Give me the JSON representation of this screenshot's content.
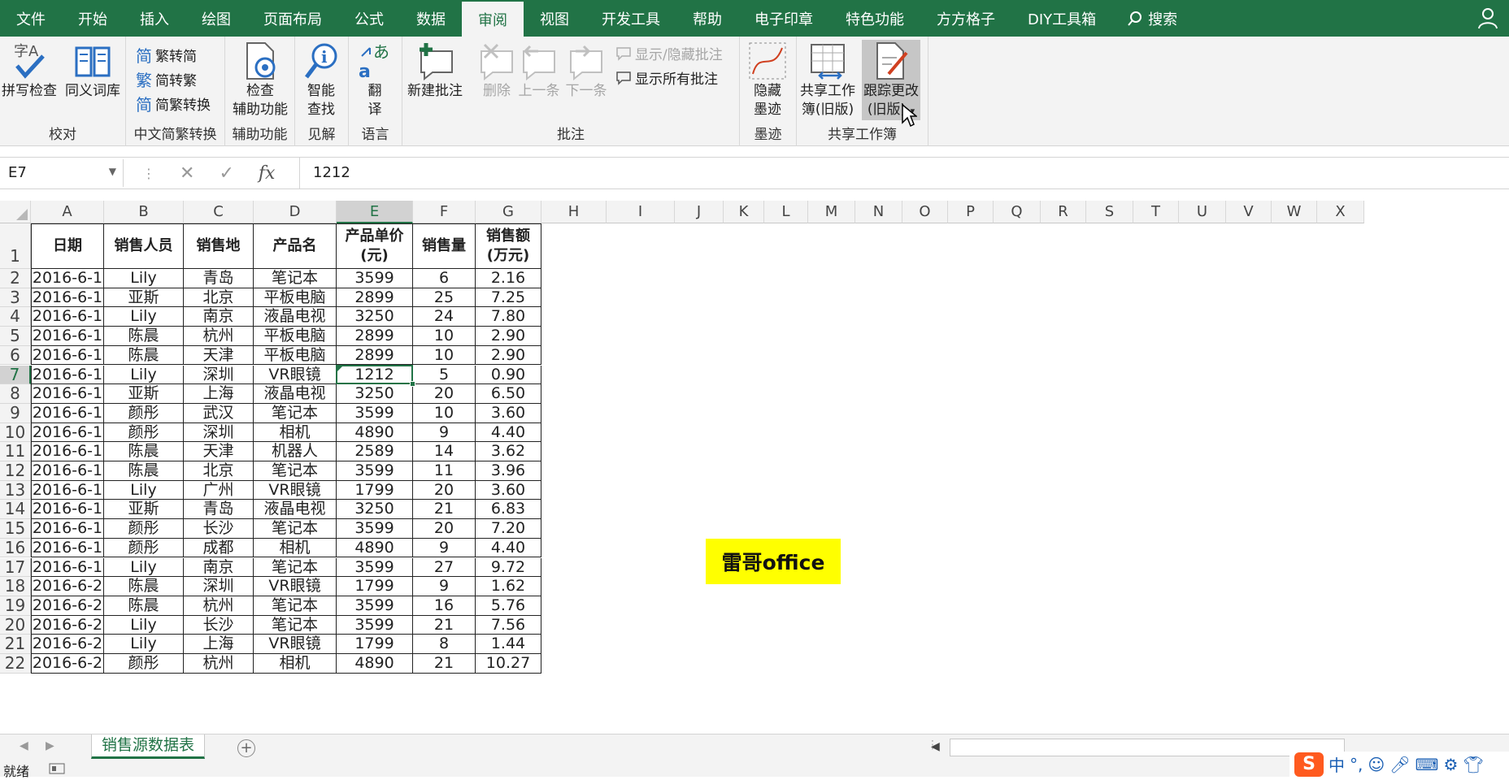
{
  "menu": {
    "tabs": [
      "文件",
      "开始",
      "插入",
      "绘图",
      "页面布局",
      "公式",
      "数据",
      "审阅",
      "视图",
      "开发工具",
      "帮助",
      "电子印章",
      "特色功能",
      "方方格子",
      "DIY工具箱"
    ],
    "active_tab": "审阅",
    "search_label": "搜索"
  },
  "ribbon": {
    "proofing": {
      "spell_check": "拼写检查",
      "thesaurus": "同义词库",
      "group": "校对"
    },
    "chinese": {
      "trad_to_simp": "繁转简",
      "simp_to_trad": "简转繁",
      "convert": "简繁转换",
      "group": "中文简繁转换"
    },
    "accessibility": {
      "check_line1": "检查",
      "check_line2": "辅助功能",
      "group": "辅助功能"
    },
    "insights": {
      "smart_line1": "智能",
      "smart_line2": "查找",
      "group": "见解"
    },
    "language": {
      "translate_line1": "翻",
      "translate_line2": "译",
      "group": "语言"
    },
    "comments": {
      "new": "新建批注",
      "delete": "删除",
      "prev": "上一条",
      "next": "下一条",
      "show_hide": "显示/隐藏批注",
      "show_all": "显示所有批注",
      "group": "批注"
    },
    "ink": {
      "hide_line1": "隐藏",
      "hide_line2": "墨迹",
      "group": "墨迹"
    },
    "shared": {
      "share_line1": "共享工作",
      "share_line2": "簿(旧版)",
      "track_line1": "跟踪更改",
      "track_line2": "(旧版)",
      "group": "共享工作簿"
    }
  },
  "formula_bar": {
    "name_box": "E7",
    "value": "1212",
    "fx": "fx"
  },
  "columns": [
    "A",
    "B",
    "C",
    "D",
    "E",
    "F",
    "G",
    "H",
    "I",
    "J",
    "K",
    "L",
    "M",
    "N",
    "O",
    "P",
    "Q",
    "R",
    "S",
    "T",
    "U",
    "V",
    "W",
    "X"
  ],
  "row_numbers": [
    "1",
    "2",
    "3",
    "4",
    "5",
    "6",
    "7",
    "8",
    "9",
    "10",
    "11",
    "12",
    "13",
    "14",
    "15",
    "16",
    "17",
    "18",
    "19",
    "20",
    "21",
    "22"
  ],
  "selected": {
    "column": "E",
    "row": "7"
  },
  "table": {
    "headers": [
      "日期",
      "销售人员",
      "销售地",
      "产品名",
      "产品单价\n(元)",
      "销售量",
      "销售额\n(万元)"
    ],
    "rows": [
      [
        "2016-6-1",
        "Lily",
        "青岛",
        "笔记本",
        "3599",
        "6",
        "2.16"
      ],
      [
        "2016-6-1",
        "亚斯",
        "北京",
        "平板电脑",
        "2899",
        "25",
        "7.25"
      ],
      [
        "2016-6-1",
        "Lily",
        "南京",
        "液晶电视",
        "3250",
        "24",
        "7.80"
      ],
      [
        "2016-6-1",
        "陈晨",
        "杭州",
        "平板电脑",
        "2899",
        "10",
        "2.90"
      ],
      [
        "2016-6-1",
        "陈晨",
        "天津",
        "平板电脑",
        "2899",
        "10",
        "2.90"
      ],
      [
        "2016-6-1",
        "Lily",
        "深圳",
        "VR眼镜",
        "1212",
        "5",
        "0.90"
      ],
      [
        "2016-6-1",
        "亚斯",
        "上海",
        "液晶电视",
        "3250",
        "20",
        "6.50"
      ],
      [
        "2016-6-1",
        "颜彤",
        "武汉",
        "笔记本",
        "3599",
        "10",
        "3.60"
      ],
      [
        "2016-6-1",
        "颜彤",
        "深圳",
        "相机",
        "4890",
        "9",
        "4.40"
      ],
      [
        "2016-6-1",
        "陈晨",
        "天津",
        "机器人",
        "2589",
        "14",
        "3.62"
      ],
      [
        "2016-6-1",
        "陈晨",
        "北京",
        "笔记本",
        "3599",
        "11",
        "3.96"
      ],
      [
        "2016-6-1",
        "Lily",
        "广州",
        "VR眼镜",
        "1799",
        "20",
        "3.60"
      ],
      [
        "2016-6-1",
        "亚斯",
        "青岛",
        "液晶电视",
        "3250",
        "21",
        "6.83"
      ],
      [
        "2016-6-1",
        "颜彤",
        "长沙",
        "笔记本",
        "3599",
        "20",
        "7.20"
      ],
      [
        "2016-6-1",
        "颜彤",
        "成都",
        "相机",
        "4890",
        "9",
        "4.40"
      ],
      [
        "2016-6-1",
        "Lily",
        "南京",
        "笔记本",
        "3599",
        "27",
        "9.72"
      ],
      [
        "2016-6-2",
        "陈晨",
        "深圳",
        "VR眼镜",
        "1799",
        "9",
        "1.62"
      ],
      [
        "2016-6-2",
        "陈晨",
        "杭州",
        "笔记本",
        "3599",
        "16",
        "5.76"
      ],
      [
        "2016-6-2",
        "Lily",
        "长沙",
        "笔记本",
        "3599",
        "21",
        "7.56"
      ],
      [
        "2016-6-2",
        "Lily",
        "上海",
        "VR眼镜",
        "1799",
        "8",
        "1.44"
      ],
      [
        "2016-6-2",
        "颜彤",
        "杭州",
        "相机",
        "4890",
        "21",
        "10.27"
      ]
    ]
  },
  "watermark": "雷哥office",
  "sheet_tab": "销售源数据表",
  "status": {
    "ready": "就绪"
  },
  "ime": {
    "mode": "中",
    "punct": "°,"
  },
  "colors": {
    "accent": "#217346",
    "watermark_bg": "#ffff00"
  }
}
